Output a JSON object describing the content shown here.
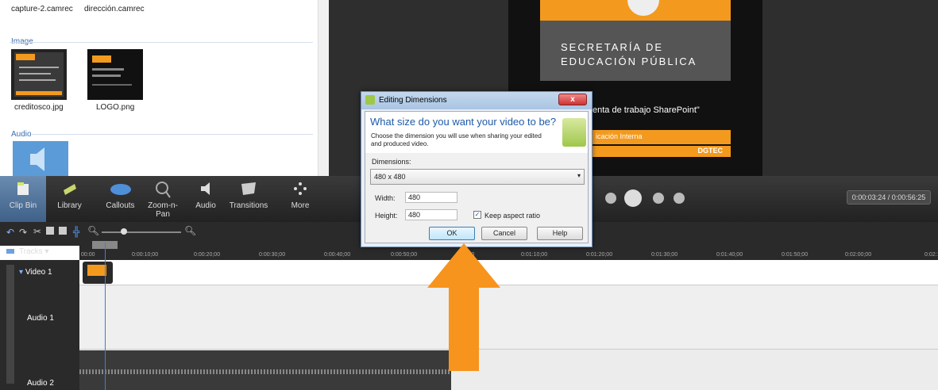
{
  "clip_bin": {
    "top_files": [
      "capture-2.camrec",
      "dirección.camrec"
    ],
    "image_section_label": "Image",
    "images": [
      "creditosco.jpg",
      "LOGO.png"
    ],
    "audio_section_label": "Audio"
  },
  "preview": {
    "slide_line1": "SECRETARÍA DE",
    "slide_line2": "EDUCACIÓN PÚBLICA",
    "slide_caption": "enta de trabajo SharePoint\"",
    "slide_footer": "icación Interna",
    "slide_badge": "DGTEC",
    "timecode": "0:00:03:24 / 0:00:56:25"
  },
  "toolbar": {
    "buttons": [
      "Clip Bin",
      "Library",
      "Callouts",
      "Zoom-n-Pan",
      "Audio",
      "Transitions",
      "More"
    ]
  },
  "timeline": {
    "tracks_label": "Tracks",
    "ticks": [
      "00:00",
      "0:00:10;00",
      "0:00:20;00",
      "0:00:30;00",
      "0:00:40;00",
      "0:00:50;00",
      "0:01:00",
      "0:01:10;00",
      "0:01:20;00",
      "0:01:30;00",
      "0:01:40;00",
      "0:01:50;00",
      "0:02:00;00",
      "0:02:1"
    ],
    "track_names": [
      "Video 1",
      "Audio 1",
      "Audio 2"
    ]
  },
  "dialog": {
    "title": "Editing Dimensions",
    "close": "x",
    "question": "What size do you want your video to be?",
    "description": "Choose the dimension you will use when sharing your edited and produced video.",
    "dimensions_label": "Dimensions:",
    "dimensions_value": "480 x 480",
    "width_label": "Width:",
    "width_value": "480",
    "height_label": "Height:",
    "height_value": "480",
    "keep_aspect_label": "Keep aspect ratio",
    "keep_aspect_checked": true,
    "ok": "OK",
    "cancel": "Cancel",
    "help": "Help"
  },
  "colors": {
    "accent_orange": "#f7941d",
    "dialog_question_blue": "#1e5aa8",
    "slide_orange": "#f39a1e"
  }
}
